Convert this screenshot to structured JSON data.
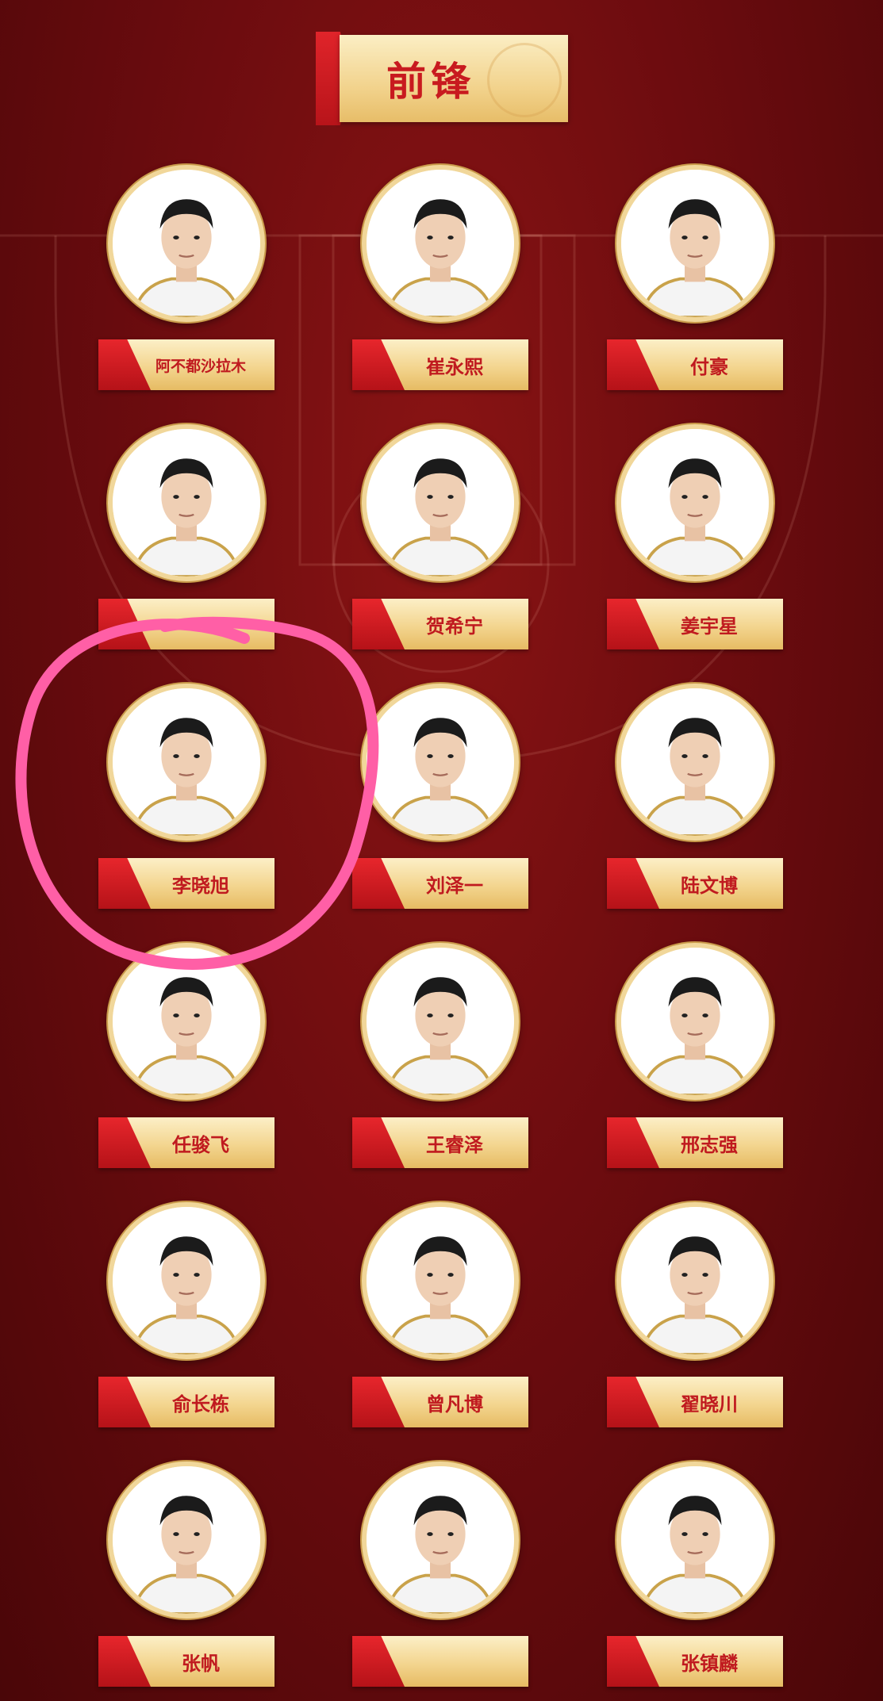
{
  "header": {
    "title": "前锋"
  },
  "colors": {
    "background": "#6d0c0f",
    "accent_red": "#c81a1f",
    "gold": "#f3d58f",
    "marker": "#ff5fa6"
  },
  "players": [
    {
      "name": "阿不都沙拉木"
    },
    {
      "name": "崔永熙"
    },
    {
      "name": "付豪"
    },
    {
      "name": ""
    },
    {
      "name": "贺希宁"
    },
    {
      "name": "姜宇星"
    },
    {
      "name": "李晓旭",
      "highlighted": true
    },
    {
      "name": "刘泽一"
    },
    {
      "name": "陆文博"
    },
    {
      "name": "任骏飞"
    },
    {
      "name": "王睿泽"
    },
    {
      "name": "邢志强"
    },
    {
      "name": "俞长栋"
    },
    {
      "name": "曾凡博"
    },
    {
      "name": "翟晓川"
    },
    {
      "name": "张帆"
    },
    {
      "name": ""
    },
    {
      "name": "张镇麟"
    }
  ]
}
